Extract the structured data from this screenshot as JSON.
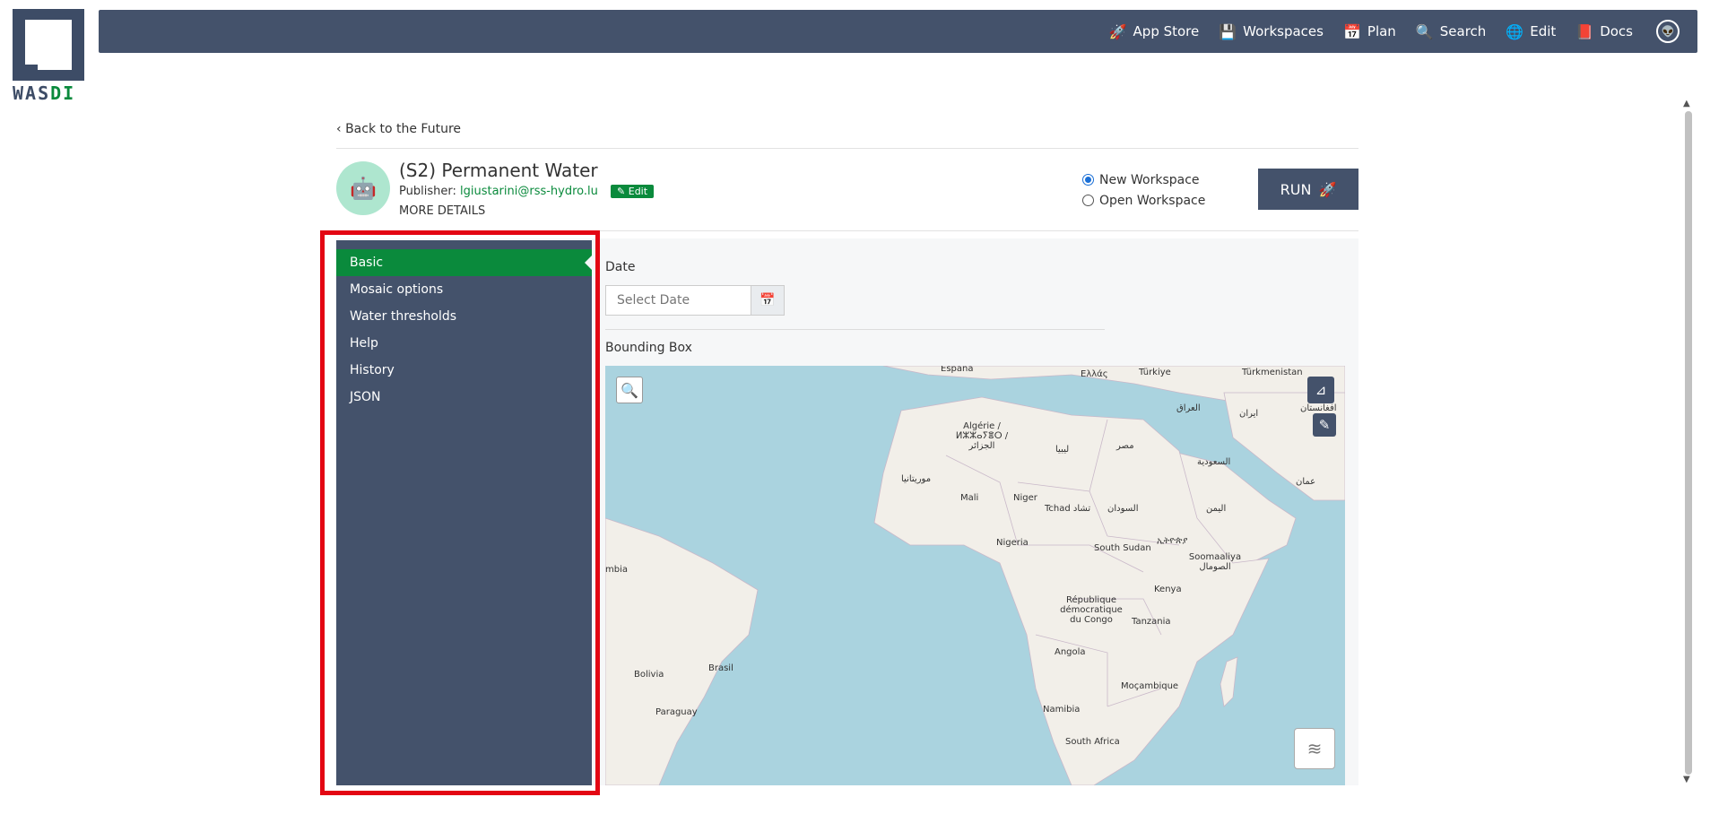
{
  "brand": {
    "logo_text": "WASDI"
  },
  "topnav": {
    "items": [
      {
        "label": "App Store",
        "icon": "rocket-icon",
        "glyph": "🚀"
      },
      {
        "label": "Workspaces",
        "icon": "save-icon",
        "glyph": "💾"
      },
      {
        "label": "Plan",
        "icon": "calendar-icon",
        "glyph": "📅"
      },
      {
        "label": "Search",
        "icon": "search-icon",
        "glyph": "🔍"
      },
      {
        "label": "Edit",
        "icon": "globe-icon",
        "glyph": "🌐"
      },
      {
        "label": "Docs",
        "icon": "book-icon",
        "glyph": "📕"
      }
    ],
    "avatar_glyph": "👽"
  },
  "page": {
    "back_label": "Back to the Future",
    "app_title": "(S2) Permanent Water",
    "publisher_label": "Publisher:",
    "publisher_email": "lgiustarini@rss-hydro.lu",
    "edit_label": "Edit",
    "more_details": "MORE DETAILS",
    "new_workspace": "New Workspace",
    "open_workspace": "Open Workspace",
    "run_label": "RUN"
  },
  "sidebar": {
    "items": [
      {
        "label": "Basic",
        "active": true
      },
      {
        "label": "Mosaic options",
        "active": false
      },
      {
        "label": "Water thresholds",
        "active": false
      },
      {
        "label": "Help",
        "active": false
      },
      {
        "label": "History",
        "active": false
      },
      {
        "label": "JSON",
        "active": false
      }
    ]
  },
  "form": {
    "date_label": "Date",
    "date_placeholder": "Select Date",
    "bbox_label": "Bounding Box"
  },
  "map": {
    "labels": [
      "España",
      "Ελλάς",
      "Türkiye",
      "Türkmenistan",
      "Algérie / ⵍⵣⵣⴰⵢⴻⵔ / الجزائر",
      "العراق",
      "ایران",
      "افغانستان",
      "ليبيا",
      "مصر",
      "السعودية",
      "موريتانيا",
      "Mali",
      "Niger",
      "Tchad تشاد",
      "السودان",
      "عمان",
      "اليمن",
      "Nigeria",
      "South Sudan",
      "ኢትዮጵያ",
      "Soomaaliya الصومال",
      "Kenya",
      "République démocratique du Congo",
      "Tanzania",
      "Angola",
      "Moçambique",
      "Namibia",
      "South Africa",
      "Bolivia",
      "Brasil",
      "Paraguay",
      "mbia"
    ]
  },
  "colors": {
    "nav": "#44526b",
    "accent": "#0a8a3c",
    "highlight": "#e30613",
    "water": "#aad3df",
    "land": "#f2efe9"
  }
}
